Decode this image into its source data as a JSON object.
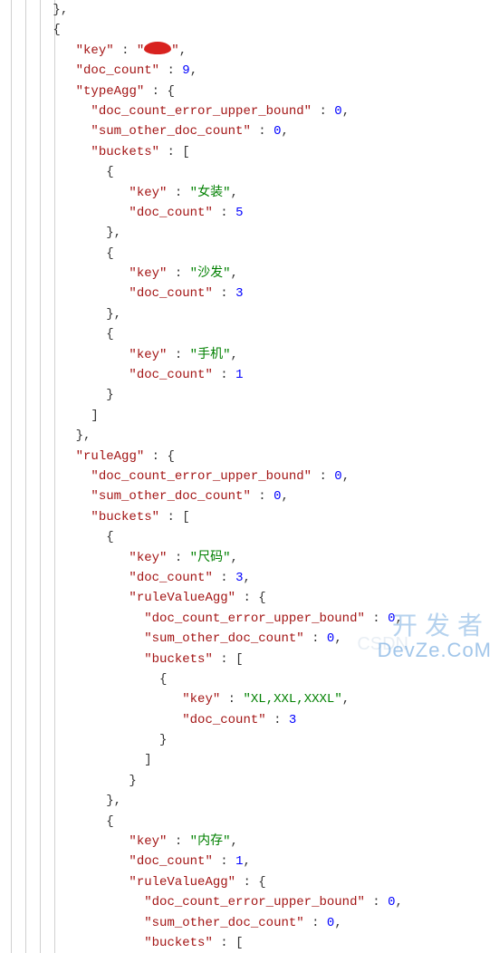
{
  "colors": {
    "key": "#a31515",
    "string": "#008000",
    "number": "#0000ff"
  },
  "watermarks": {
    "cn": "开发者",
    "en": "DevZe.CoM",
    "faint": "CSDN"
  },
  "root": {
    "key": "key",
    "key_redacted": true,
    "doc_count_label": "doc_count",
    "doc_count": 9,
    "typeAgg": {
      "label": "typeAgg",
      "err_label": "doc_count_error_upper_bound",
      "err_val": 0,
      "sum_label": "sum_other_doc_count",
      "sum_val": 0,
      "buckets_label": "buckets",
      "buckets": [
        {
          "key": "女装",
          "doc_count": 5
        },
        {
          "key": "沙发",
          "doc_count": 3
        },
        {
          "key": "手机",
          "doc_count": 1
        }
      ]
    },
    "ruleAgg": {
      "label": "ruleAgg",
      "err_label": "doc_count_error_upper_bound",
      "err_val": 0,
      "sum_label": "sum_other_doc_count",
      "sum_val": 0,
      "buckets_label": "buckets",
      "buckets": [
        {
          "key": "尺码",
          "doc_count": 3,
          "ruleValueAgg": {
            "label": "ruleValueAgg",
            "err_label": "doc_count_error_upper_bound",
            "err_val": 0,
            "sum_label": "sum_other_doc_count",
            "sum_val": 0,
            "buckets_label": "buckets",
            "buckets": [
              {
                "key": "XL,XXL,XXXL",
                "doc_count": 3
              }
            ]
          }
        },
        {
          "key": "内存",
          "doc_count": 1,
          "ruleValueAgg": {
            "label": "ruleValueAgg",
            "err_label": "doc_count_error_upper_bound",
            "err_val": 0,
            "sum_label": "sum_other_doc_count",
            "sum_val": 0,
            "buckets_label": "buckets"
          }
        }
      ]
    }
  },
  "labels": {
    "key": "key",
    "doc_count": "doc_count",
    "buckets": "buckets"
  }
}
